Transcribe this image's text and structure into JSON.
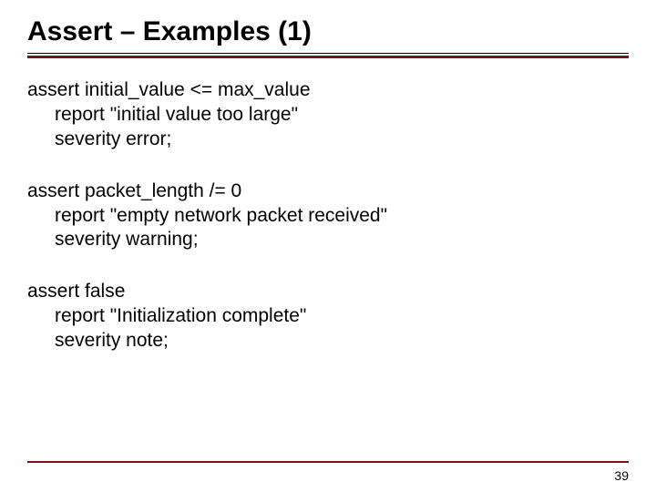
{
  "title": "Assert – Examples (1)",
  "blocks": [
    {
      "line1": "assert initial_value <= max_value",
      "line2": "report \"initial value too large\"",
      "line3": "severity error;"
    },
    {
      "line1": "assert packet_length /= 0",
      "line2": "report \"empty network packet received\"",
      "line3": "severity warning;"
    },
    {
      "line1": "assert false",
      "line2": "report \"Initialization complete\"",
      "line3": "severity note;"
    }
  ],
  "page_number": "39"
}
